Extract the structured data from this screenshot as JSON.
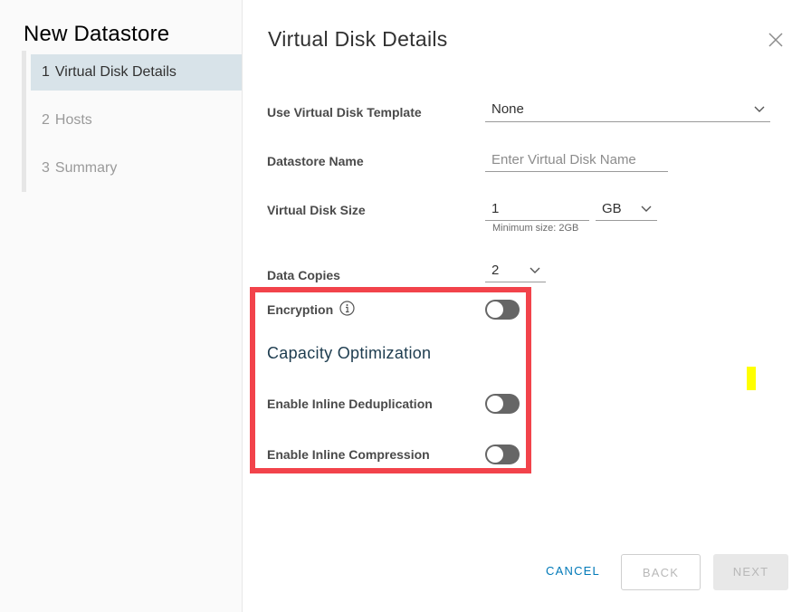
{
  "wizard": {
    "title": "New Datastore",
    "steps": [
      {
        "num": "1",
        "label": "Virtual Disk Details",
        "active": true
      },
      {
        "num": "2",
        "label": "Hosts",
        "active": false
      },
      {
        "num": "3",
        "label": "Summary",
        "active": false
      }
    ]
  },
  "page": {
    "title": "Virtual Disk Details",
    "close_icon": "close-icon"
  },
  "form": {
    "template": {
      "label": "Use Virtual Disk Template",
      "value": "None"
    },
    "name": {
      "label": "Datastore Name",
      "value": "",
      "placeholder": "Enter Virtual Disk Name"
    },
    "size": {
      "label": "Virtual Disk Size",
      "value": "1",
      "unit": "GB",
      "hint": "Minimum size: 2GB"
    },
    "copies": {
      "label": "Data Copies",
      "value": "2"
    },
    "encryption": {
      "label": "Encryption",
      "enabled": false,
      "info_icon": "info-icon"
    },
    "capacity_section": "Capacity Optimization",
    "dedup": {
      "label": "Enable Inline Deduplication",
      "enabled": false
    },
    "compression": {
      "label": "Enable Inline Compression",
      "enabled": false
    }
  },
  "footer": {
    "cancel": "CANCEL",
    "back": "BACK",
    "next": "NEXT"
  },
  "colors": {
    "highlight": "#f2434b",
    "accent": "#0079b8",
    "active_step": "#d8e3e9",
    "toggle_off": "#666666"
  }
}
